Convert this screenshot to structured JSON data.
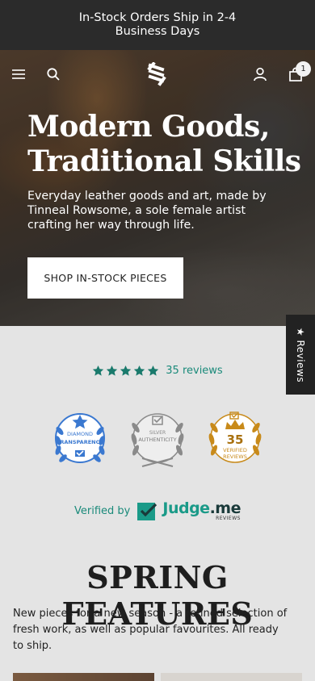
{
  "announcement": {
    "text": "In-Stock Orders Ship in 2-4 Business Days"
  },
  "header": {
    "menu_icon": "menu-icon",
    "search_icon": "search-icon",
    "logo_icon": "brand-logo",
    "account_icon": "user-icon",
    "cart_icon": "bag-icon",
    "cart_count": "1"
  },
  "hero": {
    "title": "Modern Goods, Traditional Skills",
    "subtitle": "Everyday leather goods and art, made by Tinneal Rowsome, a sole female artist crafting her way through life.",
    "cta_label": "SHOP IN-STOCK PIECES"
  },
  "reviews_tab": {
    "label": "★ Reviews"
  },
  "rating": {
    "stars": 5,
    "text": "35 reviews",
    "color": "#1a8a7a"
  },
  "badges": [
    {
      "name": "diamond-transparency",
      "line1": "DIAMOND",
      "line2": "TRANSPARENCY",
      "color": "#3a78d0"
    },
    {
      "name": "silver-authenticity",
      "line1": "SILVER",
      "line2": "AUTHENTICITY",
      "color": "#8a8a8a"
    },
    {
      "name": "verified-reviews",
      "count": "35",
      "line1": "VERIFIED",
      "line2": "REVIEWS",
      "color": "#c88a1a"
    }
  ],
  "verified": {
    "label": "Verified by",
    "brand_a": "Judge",
    "brand_b": ".me",
    "brand_sub": "REVIEWS"
  },
  "section": {
    "title": "SPRING FEATURES",
    "text": "New pieces for a new season - a refined selection of fresh work, as well as popular favourites. All ready to ship."
  }
}
